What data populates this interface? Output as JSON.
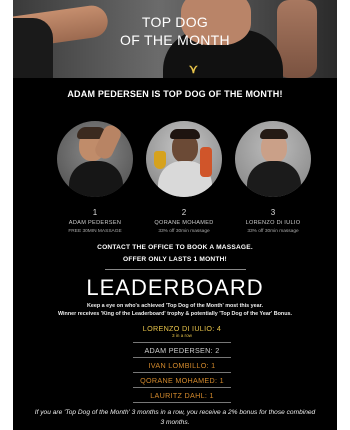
{
  "hero": {
    "title_line1": "TOP DOG",
    "title_line2": "OF THE MONTH"
  },
  "announcement": "ADAM PEDERSEN IS TOP DOG OF THE MONTH!",
  "winners": [
    {
      "rank": "1",
      "name": "ADAM PEDERSEN",
      "offer": "FREE 30MIN MASSAGE"
    },
    {
      "rank": "2",
      "name": "QORANE MOHAMED",
      "offer": "33% off 30min massage"
    },
    {
      "rank": "3",
      "name": "LORENZO Di IULIO",
      "offer": "33% off 30min massage"
    }
  ],
  "cta": {
    "line1": "CONTACT THE OFFICE TO BOOK A MASSAGE.",
    "line2": "OFFER ONLY LASTS 1 MONTH!"
  },
  "leaderboard": {
    "title": "LEADERBOARD",
    "desc_line1": "Keep a eye on who's achieved 'Top Dog of the Month' most this year.",
    "desc_line2": "Winner receives 'King of the Leaderboard' trophy & potentially 'Top Dog of the Year' Bonus.",
    "entries": [
      {
        "text": "LORENZO DI IULIO: 4",
        "sub": "3 in a row",
        "color": "#e8c44a"
      },
      {
        "text": "ADAM PEDERSEN: 2",
        "color": "#cfcfcf"
      },
      {
        "text": "IVAN LOMBILLO: 1",
        "color": "#d48a2c"
      },
      {
        "text": "QORANE MOHAMED: 1",
        "color": "#d48a2c"
      },
      {
        "text": "LAURITZ DAHL: 1",
        "color": "#d48a2c"
      }
    ]
  },
  "footnote": "If you are 'Top Dog of the Month' 3 months in a row, you receive a 2% bonus for those combined 3 months."
}
